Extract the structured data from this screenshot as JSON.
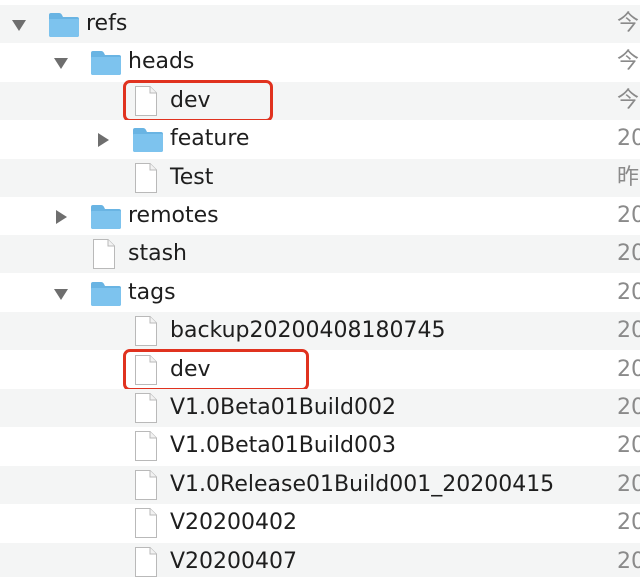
{
  "rows": [
    {
      "name": "refs",
      "kind": "folder",
      "depth": 0,
      "disclosure": "open",
      "date": "今"
    },
    {
      "name": "heads",
      "kind": "folder",
      "depth": 1,
      "disclosure": "open",
      "date": "今"
    },
    {
      "name": "dev",
      "kind": "file",
      "depth": 2,
      "disclosure": "none",
      "date": "今",
      "highlighted": true
    },
    {
      "name": "feature",
      "kind": "folder",
      "depth": 2,
      "disclosure": "closed",
      "date": "20"
    },
    {
      "name": "Test",
      "kind": "file",
      "depth": 2,
      "disclosure": "none",
      "date": "昨"
    },
    {
      "name": "remotes",
      "kind": "folder",
      "depth": 1,
      "disclosure": "closed",
      "date": "20"
    },
    {
      "name": "stash",
      "kind": "file",
      "depth": 1,
      "disclosure": "none",
      "date": "20"
    },
    {
      "name": "tags",
      "kind": "folder",
      "depth": 1,
      "disclosure": "open",
      "date": "20"
    },
    {
      "name": "backup20200408180745",
      "kind": "file",
      "depth": 2,
      "disclosure": "none",
      "date": "20"
    },
    {
      "name": "dev",
      "kind": "file",
      "depth": 2,
      "disclosure": "none",
      "date": "20",
      "highlighted": true
    },
    {
      "name": "V1.0Beta01Build002",
      "kind": "file",
      "depth": 2,
      "disclosure": "none",
      "date": "20"
    },
    {
      "name": "V1.0Beta01Build003",
      "kind": "file",
      "depth": 2,
      "disclosure": "none",
      "date": "20"
    },
    {
      "name": "V1.0Release01Build001_20200415",
      "kind": "file",
      "depth": 2,
      "disclosure": "none",
      "date": "20"
    },
    {
      "name": "V20200402",
      "kind": "file",
      "depth": 2,
      "disclosure": "none",
      "date": "20"
    },
    {
      "name": "V20200407",
      "kind": "file",
      "depth": 2,
      "disclosure": "none",
      "date": "20"
    }
  ],
  "colors": {
    "folder": "#7dc3ee",
    "folder_tab": "#69b4e3",
    "highlight": "#e0321f",
    "row_alt": "#f4f5f5"
  },
  "icons": {
    "folder": "folder-icon",
    "file": "file-icon",
    "open": "disclosure-open-icon",
    "closed": "disclosure-closed-icon"
  }
}
